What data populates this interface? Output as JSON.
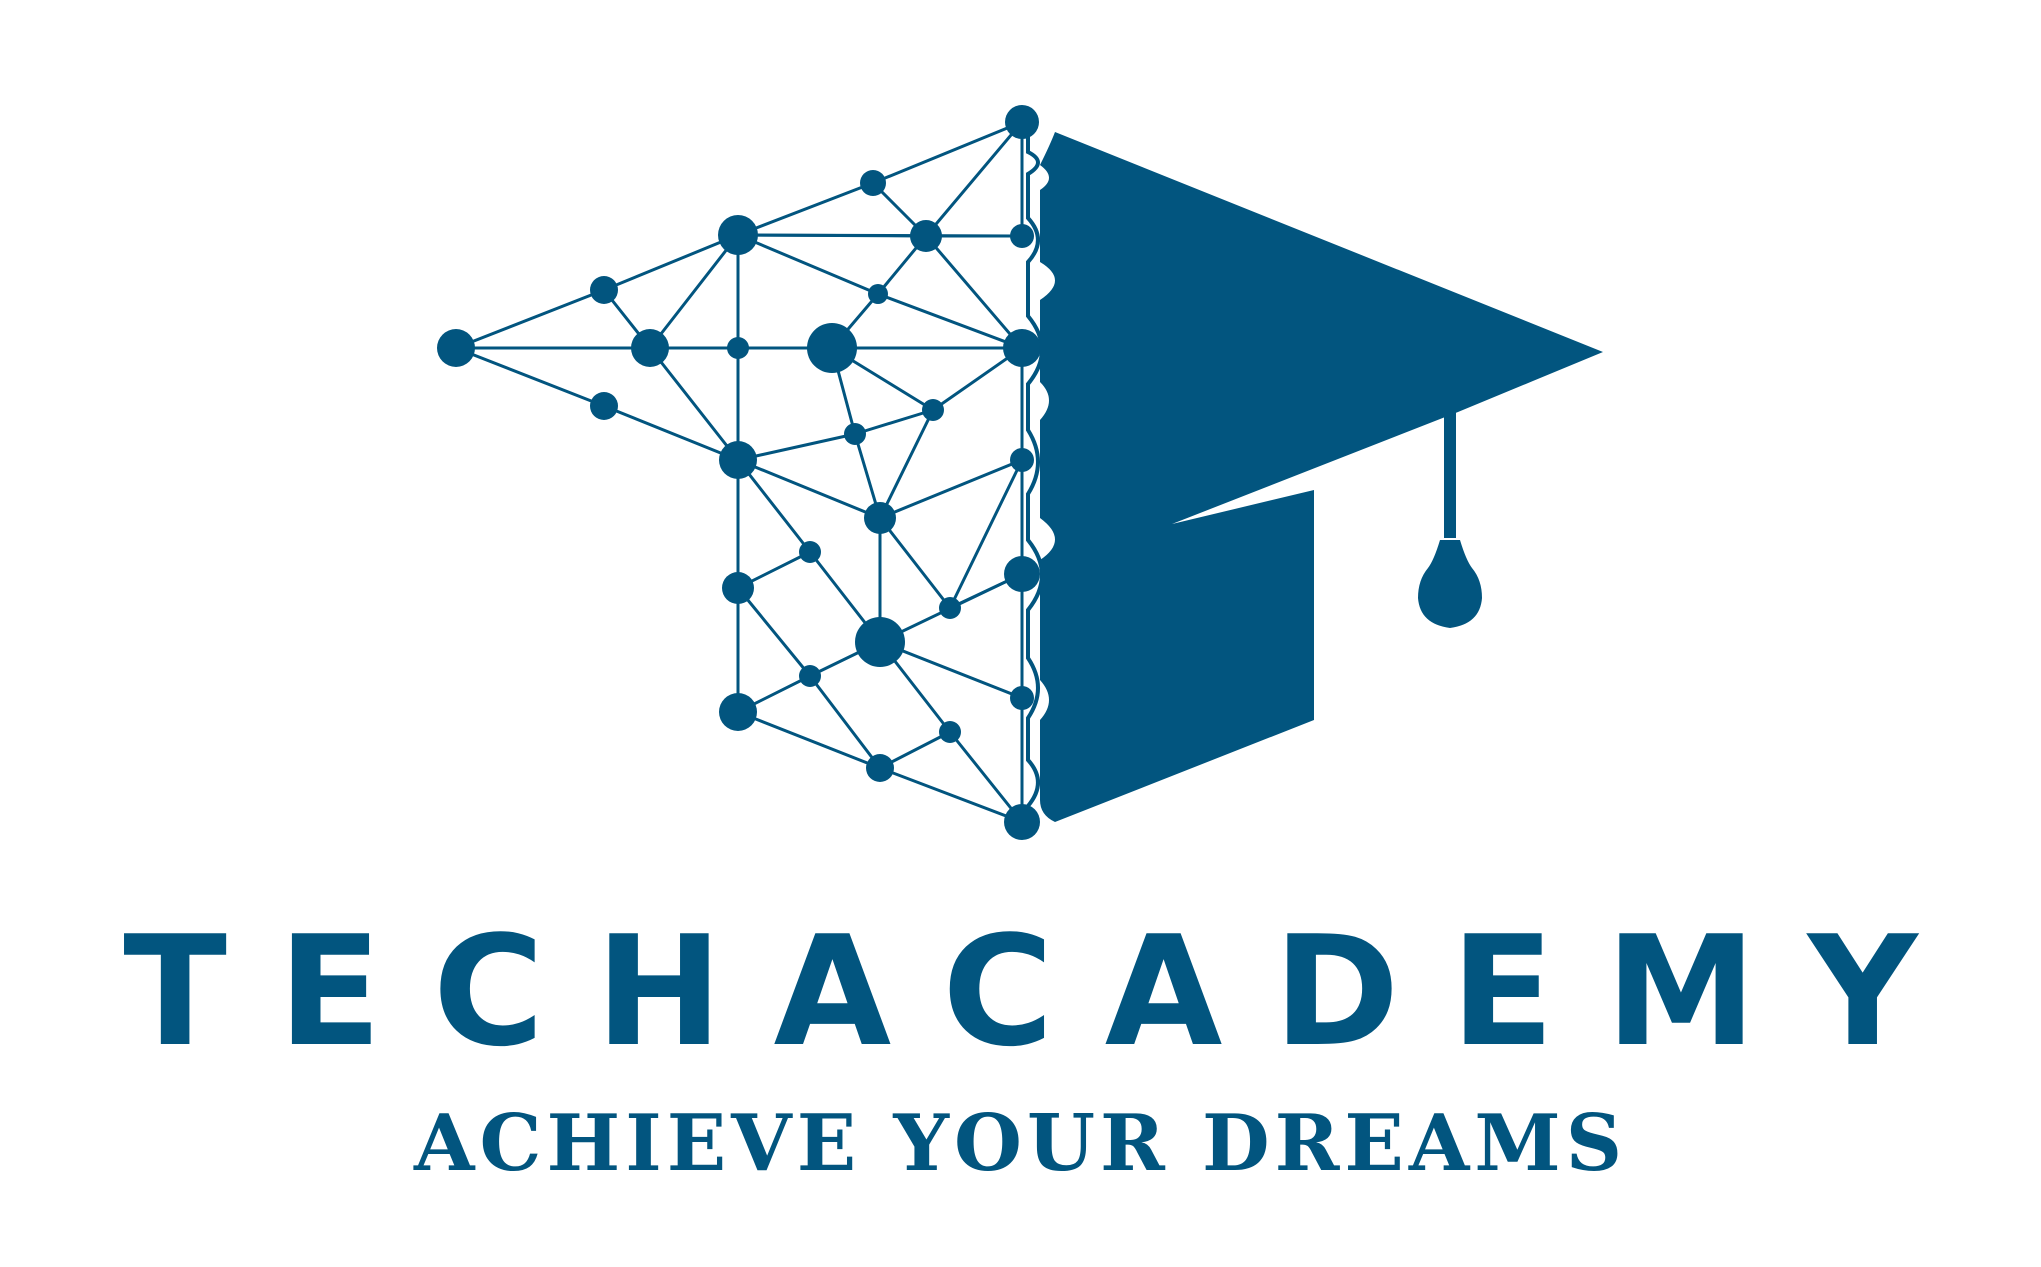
{
  "brand": {
    "name": "TECHACADEMY",
    "tagline": "ACHIEVE YOUR DREAMS",
    "color": "#02557f"
  },
  "logo": {
    "icon": "network-graduation-cap-icon"
  }
}
